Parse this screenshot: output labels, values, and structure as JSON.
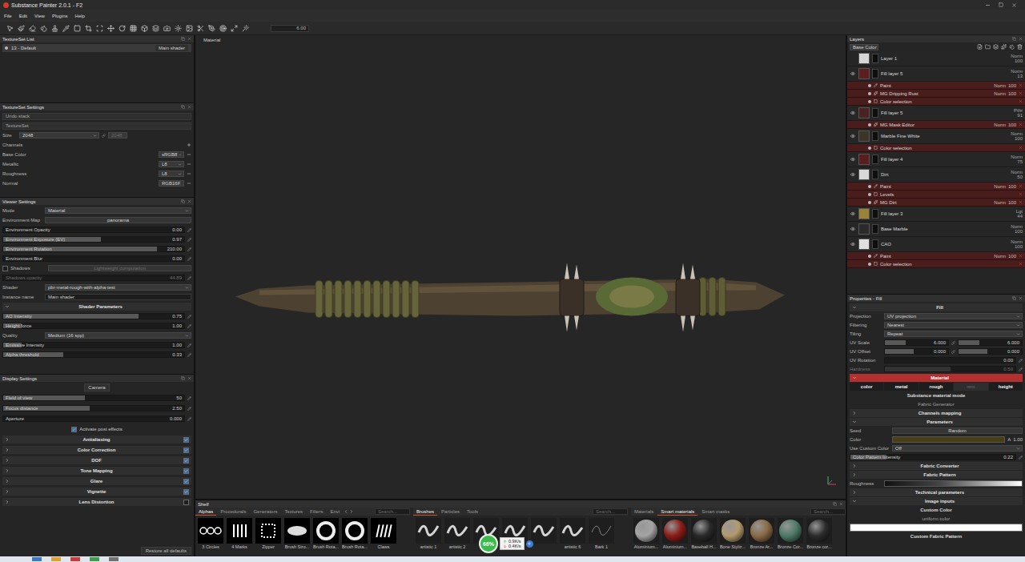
{
  "window": {
    "title": "Substance Painter 2.0.1 - F2"
  },
  "menu": [
    "File",
    "Edit",
    "View",
    "Plugins",
    "Help"
  ],
  "toolbar": {
    "value": "6.00"
  },
  "textureset_list": {
    "title": "TextureSet List",
    "rows": [
      {
        "name": "13 - Default",
        "shader": "Main shader",
        "selected": true
      }
    ]
  },
  "textureset_settings": {
    "title": "TextureSet Settings",
    "undo": "Undo stack",
    "name": "TextureSet",
    "size_label": "Size",
    "size": "2048",
    "size_linked": "2048",
    "channels_label": "Channels",
    "channels": [
      {
        "name": "Base Color",
        "format": "sRGB8"
      },
      {
        "name": "Metallic",
        "format": "L8"
      },
      {
        "name": "Roughness",
        "format": "L8"
      },
      {
        "name": "Normal",
        "format": "RGB16F"
      }
    ]
  },
  "viewer_settings": {
    "title": "Viewer Settings",
    "rows": [
      {
        "kind": "select",
        "label": "Mode",
        "value": "Material"
      },
      {
        "kind": "button",
        "label": "Environment Map",
        "value": "panorama"
      },
      {
        "kind": "slider",
        "label": "Environment Opacity",
        "value": "0.00",
        "level": 0,
        "disabled": false
      },
      {
        "kind": "slider",
        "label": "Environment Exposure (EV)",
        "value": "0.97",
        "level": 0.54,
        "disabled": false
      },
      {
        "kind": "slider",
        "label": "Environment Rotation",
        "value": "210.00",
        "level": 0.85,
        "disabled": false
      },
      {
        "kind": "slider",
        "label": "Environment Blur",
        "value": "0.00",
        "level": 0,
        "disabled": false
      },
      {
        "kind": "checkbox",
        "label": "Shadows",
        "checked": false,
        "value": "Lightweight computation"
      },
      {
        "kind": "slider",
        "label": "Shadows opacity",
        "value": "44.89",
        "level": 0,
        "disabled": true
      },
      {
        "kind": "select",
        "label": "Shader",
        "value": "pbr-metal-rough-with-alpha-test"
      },
      {
        "kind": "field",
        "label": "Instance name",
        "value": "Main shader"
      },
      {
        "kind": "section",
        "label": "Shader Parameters",
        "expanded": true
      },
      {
        "kind": "slider",
        "label": "AO Intensity",
        "value": "0.75",
        "level": 0.75,
        "disabled": false
      },
      {
        "kind": "slider",
        "label": "Height force",
        "value": "1.00",
        "level": 0.1,
        "disabled": false
      },
      {
        "kind": "select",
        "label": "Quality",
        "value": "Medium (16 spp)"
      },
      {
        "kind": "slider",
        "label": "Emissive Intensity",
        "value": "1.00",
        "level": 0.1,
        "disabled": false
      },
      {
        "kind": "slider",
        "label": "Alpha threshold",
        "value": "0.33",
        "level": 0.33,
        "disabled": false
      }
    ]
  },
  "display_settings": {
    "title": "Display Settings",
    "camera": "Camera",
    "sliders": [
      {
        "label": "Field of view",
        "value": "50",
        "level": 0.45
      },
      {
        "label": "Focus distance",
        "value": "2.50",
        "level": 0.48
      },
      {
        "label": "Aperture",
        "value": "0.000",
        "level": 0
      }
    ],
    "post_effects": {
      "label": "Activate post effects",
      "checked": true
    },
    "sections": [
      {
        "label": "Antialiasing",
        "checked": true
      },
      {
        "label": "Color Correction",
        "checked": true
      },
      {
        "label": "DOF",
        "checked": true
      },
      {
        "label": "Tone Mapping",
        "checked": true
      },
      {
        "label": "Glare",
        "checked": true
      },
      {
        "label": "Vignette",
        "checked": true
      },
      {
        "label": "Lens Distortion",
        "checked": false
      }
    ],
    "restore": "Restore all defaults"
  },
  "viewport": {
    "mode": "Material"
  },
  "shelf": {
    "title": "Shelf",
    "panels": [
      {
        "kind": "alpha",
        "search": "Search...",
        "tabs": [
          {
            "label": "Alphas",
            "selected": true
          },
          {
            "label": "Procedurals",
            "selected": false
          },
          {
            "label": "Generators",
            "selected": false
          },
          {
            "label": "Textures",
            "selected": false
          },
          {
            "label": "Filters",
            "selected": false
          },
          {
            "label": "Envi",
            "selected": false
          }
        ],
        "items": [
          {
            "label": "3 Circles"
          },
          {
            "label": "4 Marks"
          },
          {
            "label": "Zipper"
          },
          {
            "label": "Brush Stro..."
          },
          {
            "label": "Brush Rota..."
          },
          {
            "label": "Brush Rota..."
          },
          {
            "label": "Claws"
          }
        ]
      },
      {
        "kind": "brush",
        "search": "Search...",
        "tabs": [
          {
            "label": "Brushes",
            "selected": true
          },
          {
            "label": "Particles",
            "selected": false
          },
          {
            "label": "Tools",
            "selected": false
          }
        ],
        "items": [
          {
            "label": "artistic 1"
          },
          {
            "label": "artistic 2"
          },
          {
            "label": "art"
          },
          {
            "label": ""
          },
          {
            "label": ""
          },
          {
            "label": "artistic 6"
          },
          {
            "label": "Bark 1"
          }
        ]
      },
      {
        "kind": "material",
        "search": "Search...",
        "tabs": [
          {
            "label": "Materials",
            "selected": false
          },
          {
            "label": "Smart materials",
            "selected": true
          },
          {
            "label": "Smart masks",
            "selected": false
          }
        ],
        "items": [
          {
            "label": "Aluminium...",
            "color": "#a4a4a4"
          },
          {
            "label": "Aluminium...",
            "color": "#8c1c16"
          },
          {
            "label": "Baseball H...",
            "color": "#2a2a2a"
          },
          {
            "label": "Bone Styliz...",
            "color": "#b39a6c"
          },
          {
            "label": "Bronze Ar...",
            "color": "#8a6a46"
          },
          {
            "label": "Bronze Cor...",
            "color": "#4d7a68"
          },
          {
            "label": "Bronze cor...",
            "color": "#2c2c2c"
          }
        ]
      }
    ]
  },
  "monitor": {
    "percent": "66%",
    "upload": "0.9K/s",
    "download": "0.4K/s"
  },
  "layers": {
    "title": "Layers",
    "channel": "Base Color",
    "items": [
      {
        "name": "Layer 1",
        "blend": "Norm",
        "opacity": "100",
        "visible": false,
        "color": "#d6d6d6",
        "children": []
      },
      {
        "name": "Fill layer 5",
        "blend": "Norm",
        "opacity": "13",
        "visible": true,
        "color": "#5c1e1e",
        "children": [
          {
            "name": "Paint",
            "blend": "Norm",
            "opacity": "100",
            "kind": "paint"
          },
          {
            "name": "MG Dripping Rust",
            "blend": "Norm",
            "opacity": "100",
            "kind": "filter"
          },
          {
            "name": "Color selection",
            "blend": "",
            "opacity": "",
            "kind": "selection"
          }
        ]
      },
      {
        "name": "Fill layer 5",
        "blend": "Pthr",
        "opacity": "91",
        "visible": true,
        "color": "#4a2222",
        "children": [
          {
            "name": "MG Mask Editor",
            "blend": "Norm",
            "opacity": "100",
            "kind": "filter"
          }
        ]
      },
      {
        "name": "Marble Fine White",
        "blend": "Norm",
        "opacity": "100",
        "visible": true,
        "color": "#3a3526",
        "children": [
          {
            "name": "Color selection",
            "blend": "",
            "opacity": "",
            "kind": "selection"
          }
        ]
      },
      {
        "name": "Fill layer 4",
        "blend": "Norm",
        "opacity": "75",
        "visible": true,
        "color": "#5a1c1c",
        "children": []
      },
      {
        "name": "Dirt",
        "blend": "Norm",
        "opacity": "50",
        "visible": true,
        "color": "#d8d8d8",
        "children": [
          {
            "name": "Paint",
            "blend": "Norm",
            "opacity": "100",
            "kind": "paint"
          },
          {
            "name": "Levels",
            "blend": "",
            "opacity": "",
            "kind": "levels"
          },
          {
            "name": "MG Dirt",
            "blend": "Norm",
            "opacity": "100",
            "kind": "filter"
          }
        ]
      },
      {
        "name": "Fill layer 3",
        "blend": "Lgt",
        "opacity": "44",
        "visible": true,
        "color": "#9a8336",
        "children": []
      },
      {
        "name": "Base Marble",
        "blend": "Norm",
        "opacity": "100",
        "visible": true,
        "color": "#2a2a2a",
        "children": []
      },
      {
        "name": "CAO",
        "blend": "Norm",
        "opacity": "100",
        "visible": true,
        "color": "#e0e0e0",
        "children": [
          {
            "name": "Paint",
            "blend": "Norm",
            "opacity": "100",
            "kind": "paint"
          },
          {
            "name": "Color selection",
            "blend": "",
            "opacity": "",
            "kind": "selection"
          }
        ]
      }
    ]
  },
  "properties": {
    "title": "Properties - Fill",
    "fill_header": "Fill",
    "fill_rows": [
      {
        "kind": "select",
        "label": "Projection",
        "value": "UV projection",
        "disabled": false
      },
      {
        "kind": "select",
        "label": "Filtering",
        "value": "Nearest",
        "disabled": false
      },
      {
        "kind": "select",
        "label": "Tiling",
        "value": "Repeat",
        "disabled": false
      },
      {
        "kind": "pair",
        "label": "UV Scale",
        "values": [
          "6.000",
          "6.000"
        ],
        "levels": [
          0.33,
          0.33
        ],
        "disabled": false
      },
      {
        "kind": "pair",
        "label": "UV Offset",
        "values": [
          "0.000",
          "0.000"
        ],
        "levels": [
          0.45,
          0.45
        ],
        "disabled": false
      },
      {
        "kind": "slider",
        "label": "UV Rotation",
        "value": "0.00",
        "level": 0,
        "disabled": false
      },
      {
        "kind": "slider",
        "label": "Hardness",
        "value": "0.50",
        "level": 0.5,
        "disabled": true
      }
    ],
    "material_header": "Material",
    "channels": [
      {
        "label": "color",
        "selected": true
      },
      {
        "label": "metal",
        "selected": true
      },
      {
        "label": "rough",
        "selected": true
      },
      {
        "label": "nrm",
        "selected": false
      },
      {
        "label": "height",
        "selected": true
      }
    ],
    "mode_label": "Substance material mode",
    "mode_value": "Fabric Generator",
    "material_rows": [
      {
        "kind": "section",
        "label": "Channels mapping",
        "expanded": false
      },
      {
        "kind": "section",
        "label": "Parameters",
        "expanded": true
      },
      {
        "kind": "button",
        "label": "Seed",
        "value": "Random"
      },
      {
        "kind": "color",
        "label": "Color",
        "value": "A",
        "reading": "1.00",
        "color": "#4a3e16"
      },
      {
        "kind": "select",
        "label": "Use Custom Color",
        "value": "Off"
      },
      {
        "kind": "slider",
        "label": "Color Pattern Intensity",
        "value": "0.22",
        "level": 0.22
      },
      {
        "kind": "section",
        "label": "Fabric Converter",
        "expanded": false
      },
      {
        "kind": "section",
        "label": "Fabric Pattern",
        "expanded": false
      },
      {
        "kind": "gradient",
        "label": "Roughness"
      },
      {
        "kind": "section",
        "label": "Technical parameters",
        "expanded": false
      },
      {
        "kind": "section",
        "label": "Image inputs",
        "expanded": true
      },
      {
        "kind": "title",
        "label": "Custom Color"
      },
      {
        "kind": "subtitle",
        "label": "uniform color"
      },
      {
        "kind": "swatch",
        "color": "#ffffff"
      },
      {
        "kind": "title",
        "label": "Custom Fabric Pattern"
      }
    ]
  }
}
